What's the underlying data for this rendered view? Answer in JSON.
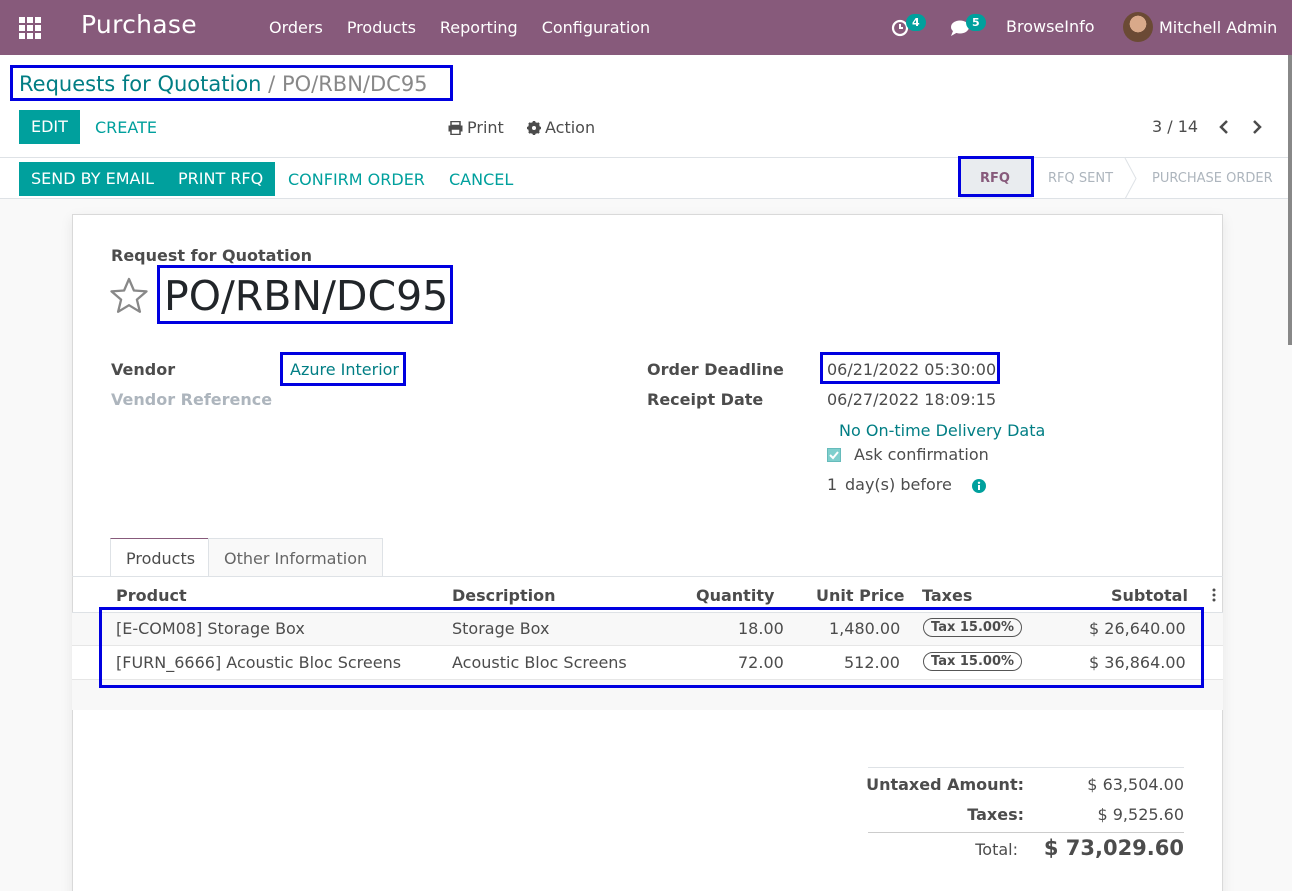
{
  "navbar": {
    "app_name": "Purchase",
    "menu": [
      "Orders",
      "Products",
      "Reporting",
      "Configuration"
    ],
    "activity_count": "4",
    "message_count": "5",
    "company": "BrowseInfo",
    "user": "Mitchell Admin"
  },
  "breadcrumb": {
    "parent": "Requests for Quotation",
    "separator": "/",
    "current": "PO/RBN/DC95"
  },
  "buttons": {
    "edit": "EDIT",
    "create": "CREATE",
    "print": "Print",
    "action": "Action",
    "send_email": "SEND BY EMAIL",
    "print_rfq": "PRINT RFQ",
    "confirm": "CONFIRM ORDER",
    "cancel": "CANCEL"
  },
  "pager": {
    "text": "3 / 14"
  },
  "status_steps": [
    "RFQ",
    "RFQ SENT",
    "PURCHASE ORDER"
  ],
  "form": {
    "doc_label": "Request for Quotation",
    "name": "PO/RBN/DC95",
    "vendor_label": "Vendor",
    "vendor": "Azure Interior",
    "vendor_ref_label": "Vendor Reference",
    "deadline_label": "Order Deadline",
    "deadline": "06/21/2022 05:30:00",
    "receipt_label": "Receipt Date",
    "receipt": "06/27/2022 18:09:15",
    "ontime": "No On-time Delivery Data",
    "ask_confirmation": "Ask confirmation",
    "days_value": "1",
    "days_label": "day(s) before"
  },
  "tabs": [
    "Products",
    "Other Information"
  ],
  "table": {
    "headers": [
      "Product",
      "Description",
      "Quantity",
      "Unit Price",
      "Taxes",
      "Subtotal"
    ],
    "rows": [
      {
        "product": "[E-COM08] Storage Box",
        "description": "Storage Box",
        "quantity": "18.00",
        "unit_price": "1,480.00",
        "tax": "Tax 15.00%",
        "subtotal": "$ 26,640.00"
      },
      {
        "product": "[FURN_6666] Acoustic Bloc Screens",
        "description": "Acoustic Bloc Screens",
        "quantity": "72.00",
        "unit_price": "512.00",
        "tax": "Tax 15.00%",
        "subtotal": "$ 36,864.00"
      }
    ]
  },
  "totals": {
    "untaxed_label": "Untaxed Amount:",
    "untaxed": "$ 63,504.00",
    "taxes_label": "Taxes:",
    "taxes": "$ 9,525.60",
    "total_label": "Total:",
    "total": "$ 73,029.60"
  }
}
